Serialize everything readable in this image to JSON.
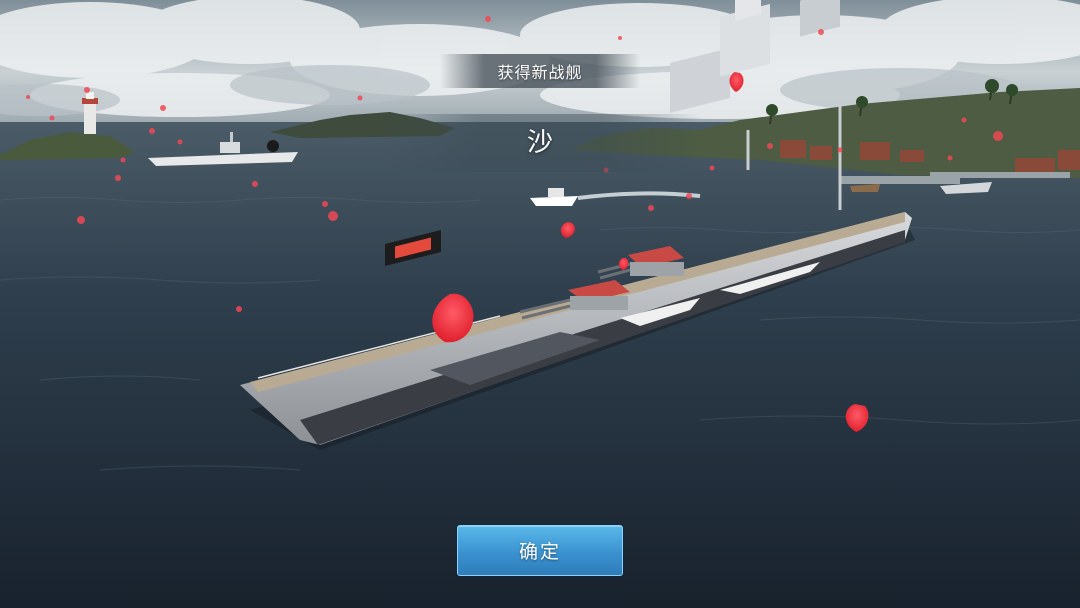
{
  "dialog": {
    "title": "获得新战舰",
    "ship_name": "沙",
    "confirm_label": "确定"
  },
  "scene": {
    "description_icon": "battleship-icon",
    "petal_icon": "petal-icon",
    "accent_color": "#3a92cf"
  }
}
